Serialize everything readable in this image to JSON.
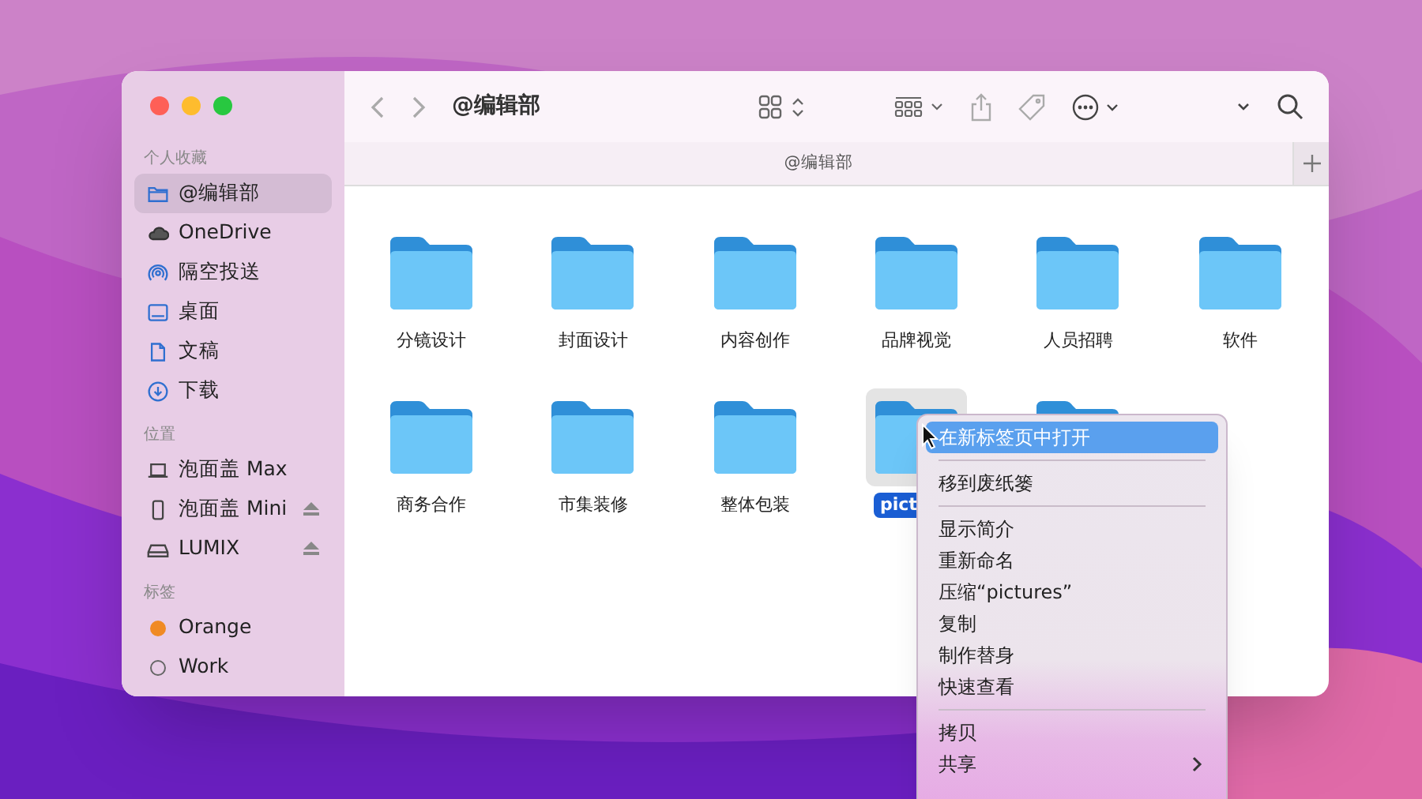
{
  "window": {
    "title": "@编辑部",
    "tab": "@编辑部"
  },
  "sidebar": {
    "sections": [
      {
        "heading": "个人收藏",
        "items": [
          {
            "label": "@编辑部",
            "kind": "folder",
            "selected": true,
            "ejectable": false
          },
          {
            "label": "OneDrive",
            "kind": "cloud",
            "selected": false,
            "ejectable": false
          },
          {
            "label": "隔空投送",
            "kind": "airdrop",
            "selected": false,
            "ejectable": false
          },
          {
            "label": "桌面",
            "kind": "desktop",
            "selected": false,
            "ejectable": false
          },
          {
            "label": "文稿",
            "kind": "document",
            "selected": false,
            "ejectable": false
          },
          {
            "label": "下载",
            "kind": "download",
            "selected": false,
            "ejectable": false
          }
        ]
      },
      {
        "heading": "位置",
        "items": [
          {
            "label": "泡面盖 Max",
            "kind": "laptop",
            "selected": false,
            "ejectable": false
          },
          {
            "label": "泡面盖 Mini",
            "kind": "phone",
            "selected": false,
            "ejectable": true
          },
          {
            "label": "LUMIX",
            "kind": "drive",
            "selected": false,
            "ejectable": true
          }
        ]
      },
      {
        "heading": "标签",
        "items": [
          {
            "label": "Orange",
            "kind": "tag",
            "color": "#f08a24",
            "selected": false,
            "ejectable": false
          },
          {
            "label": "Work",
            "kind": "tag",
            "selected": false,
            "ejectable": false
          }
        ]
      }
    ]
  },
  "files": [
    {
      "name": "分镜设计",
      "selected": false
    },
    {
      "name": "封面设计",
      "selected": false
    },
    {
      "name": "内容创作",
      "selected": false
    },
    {
      "name": "品牌视觉",
      "selected": false
    },
    {
      "name": "人员招聘",
      "selected": false
    },
    {
      "name": "软件",
      "selected": false
    },
    {
      "name": "商务合作",
      "selected": false
    },
    {
      "name": "市集装修",
      "selected": false
    },
    {
      "name": "整体包装",
      "selected": false
    },
    {
      "name": "pict",
      "selected": true
    },
    {
      "selected": false
    }
  ],
  "context_menu": {
    "groups": [
      [
        {
          "label": "在新标签页中打开",
          "highlighted": true,
          "submenu": false
        }
      ],
      [
        {
          "label": "移到废纸篓",
          "highlighted": false,
          "submenu": false
        }
      ],
      [
        {
          "label": "显示简介",
          "highlighted": false,
          "submenu": false
        },
        {
          "label": "重新命名",
          "highlighted": false,
          "submenu": false
        },
        {
          "label": "压缩“pictures”",
          "highlighted": false,
          "submenu": false
        },
        {
          "label": "复制",
          "highlighted": false,
          "submenu": false
        },
        {
          "label": "制作替身",
          "highlighted": false,
          "submenu": false
        },
        {
          "label": "快速查看",
          "highlighted": false,
          "submenu": false
        }
      ],
      [
        {
          "label": "拷贝",
          "highlighted": false,
          "submenu": false
        },
        {
          "label": "共享",
          "highlighted": false,
          "submenu": true
        }
      ]
    ]
  }
}
